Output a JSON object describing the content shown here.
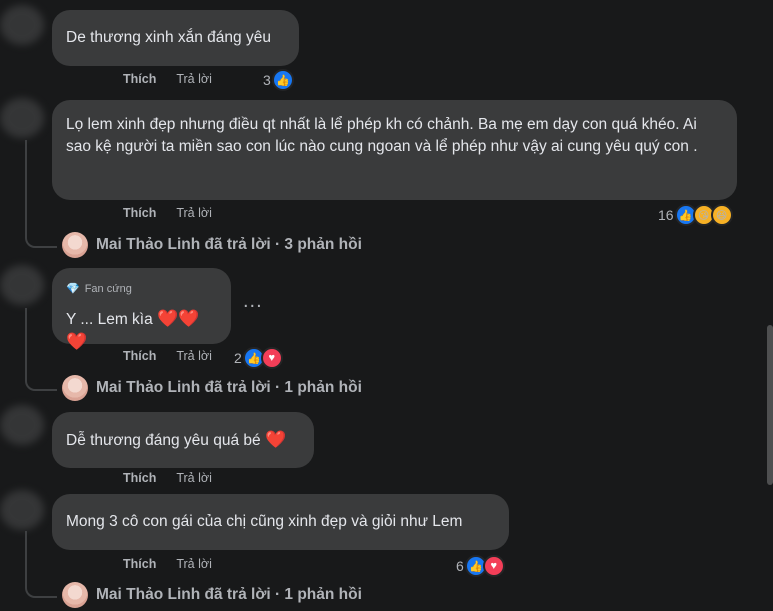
{
  "comments": [
    {
      "text": "De thương xinh xắn đáng yêu",
      "like_label": "Thích",
      "reply_label": "Trả lời",
      "reaction_count": "3"
    },
    {
      "text": "Lọ lem xinh đẹp nhưng điều qt nhất là lể phép kh có chảnh. Ba mẹ em dạy con quá khéo. Ai sao kệ người ta miền sao con lúc nào cung ngoan và lể phép như vậy ai cung yêu quý con .",
      "like_label": "Thích",
      "reply_label": "Trả lời",
      "reaction_count": "16"
    },
    {
      "badge": "Fan cứng",
      "text": "Y ... Lem kìa",
      "like_label": "Thích",
      "reply_label": "Trả lời",
      "reaction_count": "2",
      "more_label": "..."
    },
    {
      "text": "Dễ thương đáng yêu quá bé",
      "like_label": "Thích",
      "reply_label": "Trả lời"
    },
    {
      "text": "Mong 3 cô con gái của chị cũng xinh đẹp và giỏi như Lem",
      "like_label": "Thích",
      "reply_label": "Trả lời",
      "reaction_count": "6"
    }
  ],
  "reply_summaries": [
    "Mai Thảo Linh đã trả lời · 3 phản hồi",
    "Mai Thảo Linh đã trả lời · 1 phản hồi",
    "Mai Thảo Linh đã trả lời · 1 phản hồi"
  ],
  "icons": {
    "like": "like-icon",
    "love": "love-icon",
    "care": "care-icon",
    "haha": "haha-icon",
    "heart": "heart-emoji",
    "badge": "diamond-icon"
  },
  "colors": {
    "background": "#18191a",
    "bubble": "#3a3b3c",
    "like": "#1877f2",
    "love": "#f33e58",
    "heart": "#e62d2d"
  }
}
